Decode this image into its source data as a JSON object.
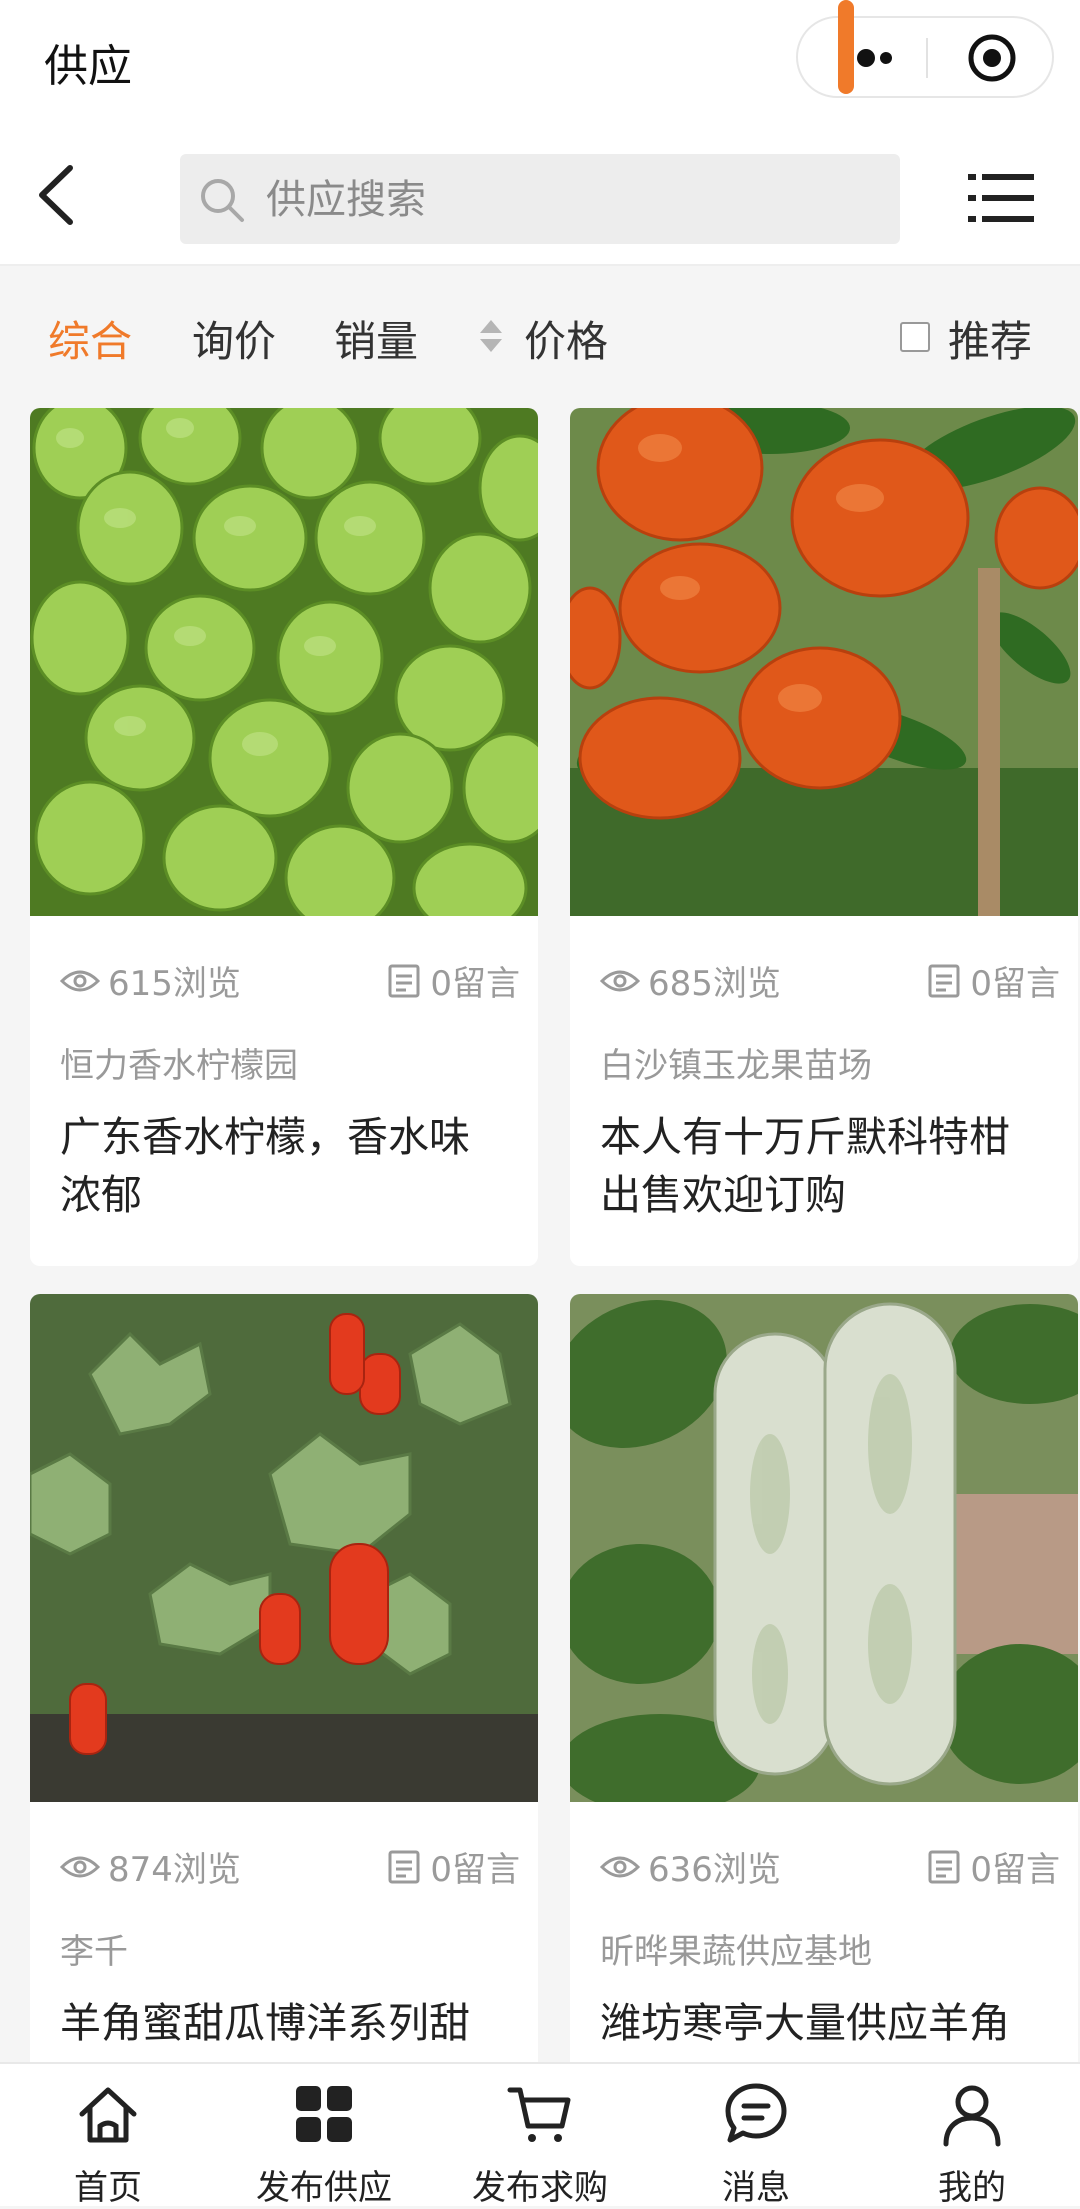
{
  "app": {
    "title": "供应"
  },
  "search": {
    "placeholder": "供应搜索"
  },
  "filters": {
    "comprehensive": "综合",
    "inquiry": "询价",
    "sales": "销量",
    "price": "价格",
    "recommend": "推荐"
  },
  "cards": [
    {
      "views": "615浏览",
      "comments": "0留言",
      "seller": "恒力香水柠檬园",
      "title": "广东香水柠檬，香水味浓郁",
      "image": "green lemons"
    },
    {
      "views": "685浏览",
      "comments": "0留言",
      "seller": "白沙镇玉龙果苗场",
      "title": "本人有十万斤默科特柑出售欢迎订购",
      "image": "orange tangerines on tree"
    },
    {
      "views": "874浏览",
      "comments": "0留言",
      "seller": "李千",
      "title": "羊角蜜甜瓜博洋系列甜",
      "image": "melon plants with red netting"
    },
    {
      "views": "636浏览",
      "comments": "0留言",
      "seller": "昕晔果蔬供应基地",
      "title": "潍坊寒亭大量供应羊角",
      "image": "long white melons on vine"
    }
  ],
  "tabs": {
    "home": "首页",
    "publish_supply": "发布供应",
    "publish_purchase": "发布求购",
    "messages": "消息",
    "mine": "我的"
  },
  "colors": {
    "accent": "#f07a2a",
    "background": "#f5f5f5",
    "muted": "#9a9a9a"
  }
}
